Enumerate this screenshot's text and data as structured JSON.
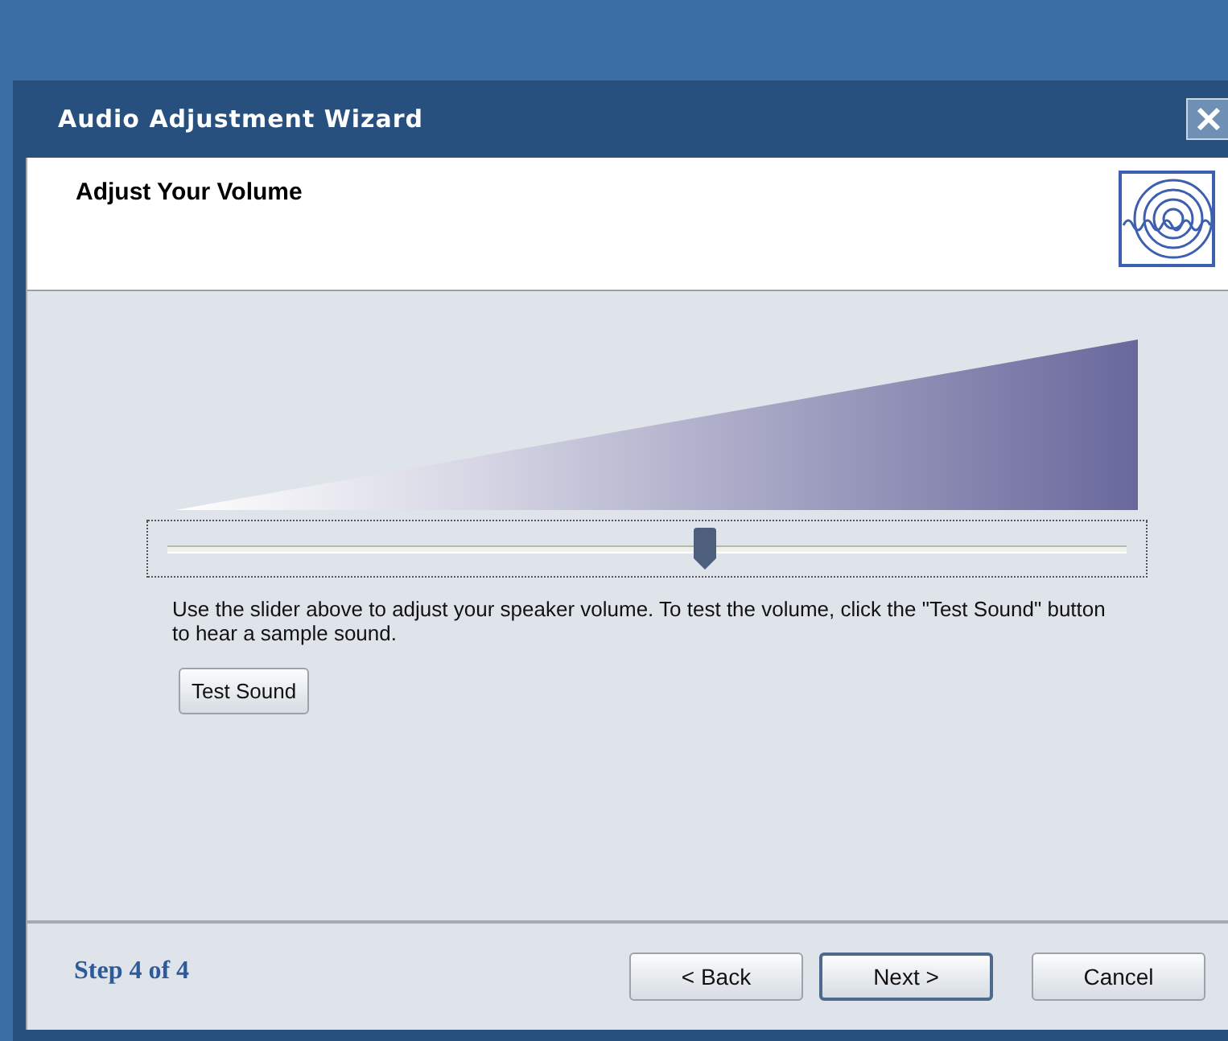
{
  "window": {
    "title": "Audio Adjustment Wizard"
  },
  "header": {
    "title": "Adjust Your Volume"
  },
  "volume_slider": {
    "level": 0.56
  },
  "instructions": "Use the slider above to adjust your speaker volume. To test the volume, click the \"Test Sound\" button to hear a sample sound.",
  "test_button": {
    "label": "Test Sound"
  },
  "footer": {
    "step": "Step 4 of 4",
    "buttons": [
      {
        "label": "< Back",
        "default": false
      },
      {
        "label": "Next >",
        "default": true
      },
      {
        "label": "Cancel",
        "default": false
      }
    ]
  }
}
